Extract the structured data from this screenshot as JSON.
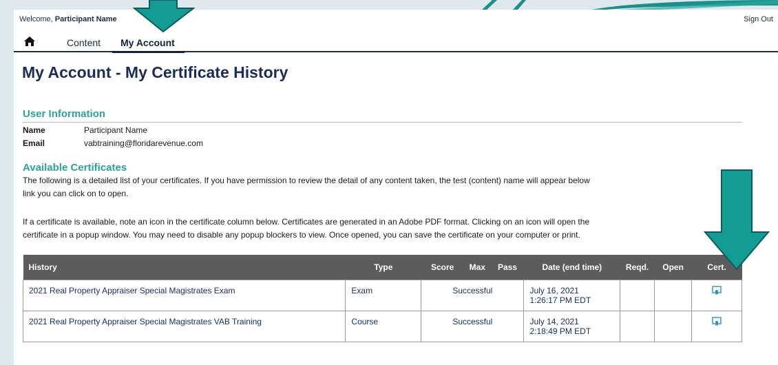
{
  "topbar": {
    "welcome_prefix": "Welcome, ",
    "welcome_name": "Participant Name",
    "sign_out": "Sign Out"
  },
  "nav": {
    "home_icon": "home-icon",
    "tabs": [
      "Content",
      "My Account"
    ]
  },
  "page_title": "My Account - My Certificate History",
  "user_info": {
    "heading": "User Information",
    "name_label": "Name",
    "name_value": "Participant Name",
    "email_label": "Email",
    "email_value": "vabtraining@floridarevenue.com"
  },
  "certificates": {
    "heading": "Available Certificates",
    "para1_line1": "The following is a detailed list of your certificates. If you have permission to review the detail of any content taken, the test (content) name will appear below",
    "para1_line2": "link you can click on to open.",
    "para2_line1": "If a certificate is available, note an icon in the certificate column below. Certificates are generated in an Adobe PDF format. Clicking on an icon will open the",
    "para2_line2": "certificate in a popup window. You may need to disable any popup blockers to view. Once opened, you can save the certificate on your computer or print."
  },
  "table": {
    "headers": [
      "History",
      "Type",
      "Score",
      "Max",
      "Pass",
      "Date (end time)",
      "Reqd.",
      "Open",
      "Cert."
    ],
    "rows": [
      {
        "history": "2021 Real Property Appraiser Special Magistrates Exam",
        "type": "Exam",
        "result": "Successful",
        "date_line1": "July 16, 2021",
        "date_line2": "1:26:17 PM EDT",
        "cert_icon": "certificate-icon"
      },
      {
        "history": "2021 Real Property Appraiser Special Magistrates VAB Training",
        "type": "Course",
        "result": "Successful",
        "date_line1": "July 14, 2021",
        "date_line2": "2:18:49 PM EDT",
        "cert_icon": "certificate-icon"
      }
    ]
  },
  "colors": {
    "accent_teal": "#139c94",
    "navy": "#1b2c5a",
    "header_gray": "#5c5c5c"
  }
}
